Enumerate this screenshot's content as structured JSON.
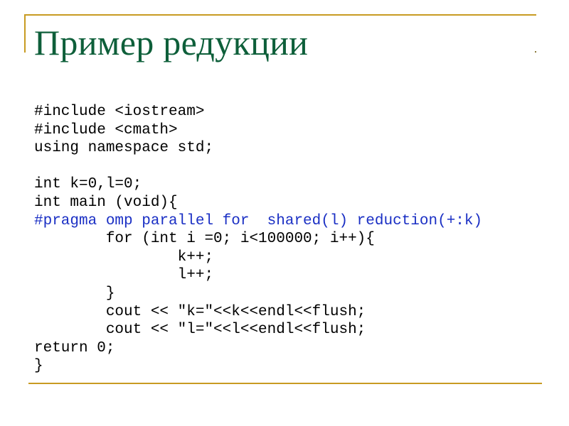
{
  "slide": {
    "title": "Пример редукции",
    "colors": {
      "title": "#0e5f3a",
      "rule": "#c89b22",
      "pragma": "#1a2fc4",
      "code": "#000000"
    },
    "code_lines": [
      {
        "text": "#include <iostream>",
        "kind": "normal"
      },
      {
        "text": "#include <cmath>",
        "kind": "normal"
      },
      {
        "text": "using namespace std;",
        "kind": "normal"
      },
      {
        "text": "",
        "kind": "blank"
      },
      {
        "text": "int k=0,l=0;",
        "kind": "normal"
      },
      {
        "text": "int main (void){",
        "kind": "normal"
      },
      {
        "text": "#pragma omp parallel for  shared(l) reduction(+:k)",
        "kind": "pragma"
      },
      {
        "text": "        for (int i =0; i<100000; i++){",
        "kind": "normal"
      },
      {
        "text": "                k++;",
        "kind": "normal"
      },
      {
        "text": "                l++;",
        "kind": "normal"
      },
      {
        "text": "        }",
        "kind": "normal"
      },
      {
        "text": "        cout << \"k=\"<<k<<endl<<flush;",
        "kind": "normal"
      },
      {
        "text": "        cout << \"l=\"<<l<<endl<<flush;",
        "kind": "normal"
      },
      {
        "text": "return 0;",
        "kind": "normal"
      },
      {
        "text": "}",
        "kind": "normal"
      }
    ]
  }
}
